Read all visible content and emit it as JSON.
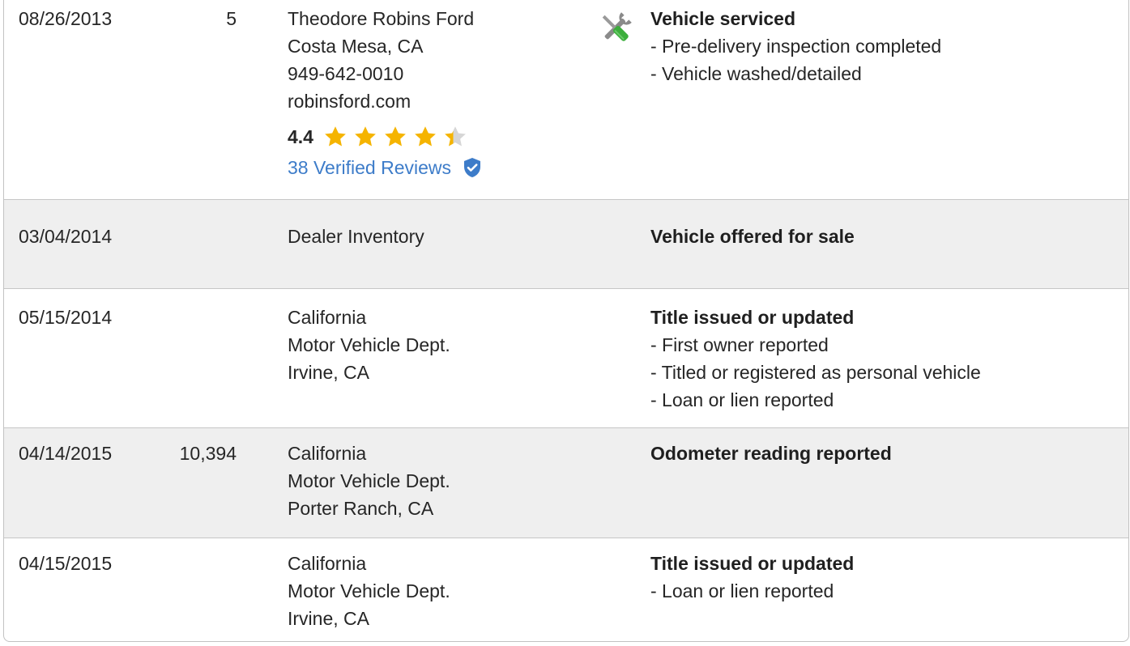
{
  "colors": {
    "link": "#3d7cc9",
    "star": "#f5b400",
    "star_empty": "#d6d6d6",
    "row_shaded": "#efefef",
    "border": "#c6c6c6"
  },
  "records": [
    {
      "date": "08/26/2013",
      "mileage": "5",
      "source": [
        "Theodore Robins Ford",
        "Costa Mesa, CA",
        "949-642-0010",
        "robinsford.com"
      ],
      "rating": {
        "score": "4.4",
        "stars_value": 4.4,
        "stars_max": 5,
        "reviews_label": "38 Verified Reviews",
        "badge_icon": "verified-shield-icon"
      },
      "icon": "service-tools-icon",
      "title": "Vehicle serviced",
      "details": [
        "- Pre-delivery inspection completed",
        "- Vehicle washed/detailed"
      ]
    },
    {
      "date": "03/04/2014",
      "mileage": "",
      "source": [
        "Dealer Inventory"
      ],
      "title": "Vehicle offered for sale",
      "details": []
    },
    {
      "date": "05/15/2014",
      "mileage": "",
      "source": [
        "California",
        "Motor Vehicle Dept.",
        "Irvine, CA"
      ],
      "title": "Title issued or updated",
      "details": [
        "- First owner reported",
        "- Titled or registered as personal vehicle",
        "- Loan or lien reported"
      ]
    },
    {
      "date": "04/14/2015",
      "mileage": "10,394",
      "source": [
        "California",
        "Motor Vehicle Dept.",
        "Porter Ranch, CA"
      ],
      "title": "Odometer reading reported",
      "details": []
    },
    {
      "date": "04/15/2015",
      "mileage": "",
      "source": [
        "California",
        "Motor Vehicle Dept.",
        "Irvine, CA"
      ],
      "title": "Title issued or updated",
      "details": [
        "- Loan or lien reported"
      ]
    }
  ]
}
